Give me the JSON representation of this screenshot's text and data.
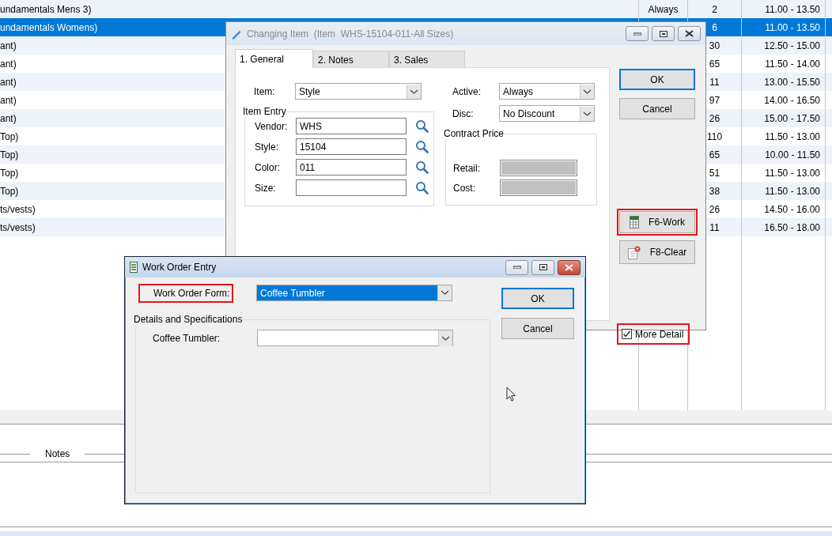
{
  "table": {
    "rows": [
      {
        "column_1": "undamentals Mens 3)",
        "column_2": "Always",
        "column_3": "2",
        "column_4": "11.00 - 13.50",
        "selected": false
      },
      {
        "column_1": "undamentals Womens)",
        "column_3": "6",
        "column_4": "11.00 - 13.50",
        "selected": true
      },
      {
        "column_1": "ant)",
        "column_3": "30",
        "column_4": "12.50 - 15.00",
        "selected": false
      },
      {
        "column_1": "ant)",
        "column_3": "65",
        "column_4": "11.50 - 14.00",
        "selected": false
      },
      {
        "column_1": "ant)",
        "column_3": "11",
        "column_4": "13.00 - 15.50",
        "selected": false
      },
      {
        "column_1": "ant)",
        "column_3": "97",
        "column_4": "14.00 - 16.50",
        "selected": false
      },
      {
        "column_1": "ant)",
        "column_3": "26",
        "column_4": "15.00 - 17.50",
        "selected": false
      },
      {
        "column_1": "Top)",
        "column_3": "110",
        "column_4": "11.50 - 13.00",
        "selected": false
      },
      {
        "column_1": "Top)",
        "column_3": "65",
        "column_4": "10.00 - 11.50",
        "selected": false
      },
      {
        "column_1": "Top)",
        "column_3": "51",
        "column_4": "11.50 - 13.00",
        "selected": false
      },
      {
        "column_1": "Top)",
        "column_3": "38",
        "column_4": "11.50 - 13.00",
        "selected": false
      },
      {
        "column_1": "ts/vests)",
        "column_3": "26",
        "column_4": "14.50 - 16.00",
        "selected": false
      },
      {
        "column_1": "ts/vests)",
        "column_3": "11",
        "column_4": "16.50 - 18.00",
        "selected": false
      }
    ]
  },
  "notes_section": {
    "label": "Notes"
  },
  "changing_item_dialog": {
    "title": "Changing Item  (Item  WHS-15104-011-All Sizes)",
    "tabs": [
      {
        "label": "1. General",
        "selected": true
      },
      {
        "label": "2. Notes",
        "selected": false
      },
      {
        "label": "3. Sales",
        "selected": false
      }
    ],
    "item": {
      "label": "Item:",
      "value": "Style"
    },
    "item_entry": {
      "title": "Item Entry",
      "fields": [
        {
          "label": "Vendor:",
          "value": "WHS"
        },
        {
          "label": "Style:",
          "value": "15104"
        },
        {
          "label": "Color:",
          "value": "011"
        },
        {
          "label": "Size:"
        }
      ]
    },
    "active": {
      "label": "Active:",
      "value": "Always"
    },
    "disc": {
      "label": "Disc:",
      "value": "No Discount"
    },
    "contract_price": {
      "title": "Contract Price",
      "fields": [
        {
          "label": "Retail:",
          "disabled": true
        },
        {
          "label": "Cost:",
          "disabled": true
        }
      ]
    },
    "buttons": [
      {
        "label": "OK",
        "kind": "default",
        "highlighted": false
      },
      {
        "label": "Cancel",
        "kind": "plain",
        "highlighted": false
      },
      {
        "label": "F6-Work",
        "kind": "work",
        "highlighted": true
      },
      {
        "label": "F8-Clear",
        "kind": "clear",
        "highlighted": false
      }
    ],
    "more_detail": {
      "label": "More Detail",
      "checked": true,
      "highlighted": true
    }
  },
  "work_order_dialog": {
    "title": "Work Order Entry",
    "form": {
      "label": "Work Order Form:",
      "value": "Coffee Tumbler",
      "highlighted": true,
      "focused": true
    },
    "details": {
      "title": "Details and Specifications",
      "fields": [
        {
          "label": "Coffee Tumbler:"
        }
      ]
    },
    "buttons": [
      {
        "label": "OK",
        "kind": "default",
        "highlighted": false
      },
      {
        "label": "Cancel",
        "kind": "plain",
        "highlighted": false
      }
    ]
  }
}
